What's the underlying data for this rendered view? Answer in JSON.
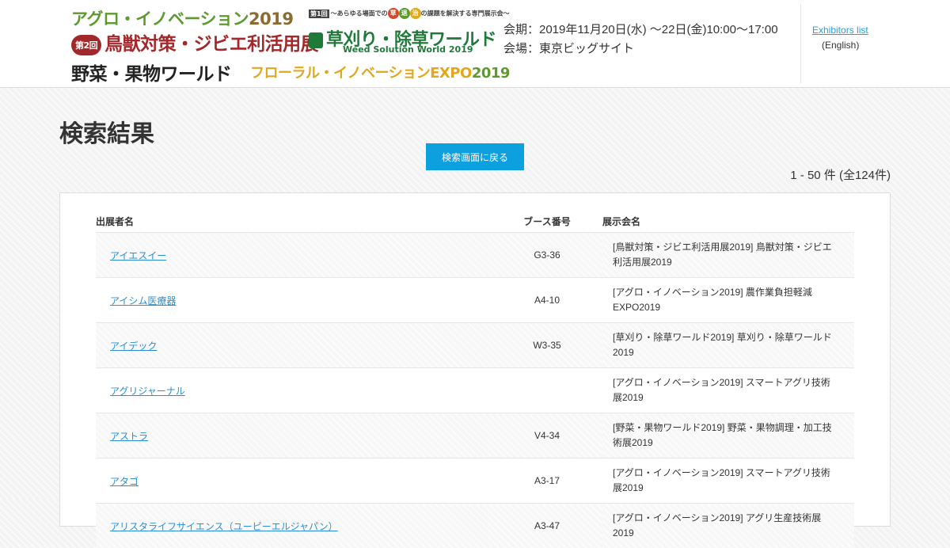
{
  "header": {
    "logo": {
      "agro": "アグロ・イノベーション",
      "agro_year": "2019",
      "tagline_badge": "第1回",
      "tagline": "～あらゆる場面での",
      "tagline_chars": [
        "草",
        "退",
        "治"
      ],
      "tagline_end": "の課題を解決する専門展示会～",
      "chouju_badge": "第2回",
      "chouju": "鳥獣対策・ジビエ利活用展",
      "kusa": "草刈り・除草ワールド",
      "weed": "Weed Solution World 2019",
      "yasai": "野菜・果物ワールド",
      "floral": "フローラル・イノベーションEXPO",
      "floral_year": "2019"
    },
    "dates_line1": "会期：2019年11月20日(水) ～22日(金)10:00～17:00",
    "dates_line2": "会場：東京ビッグサイト",
    "exhibitors_link": "Exhibitors list",
    "english_label": "(English)"
  },
  "main": {
    "title": "検索結果",
    "back_button": "検索画面に戻る",
    "count": "1 - 50 件 (全124件)"
  },
  "table": {
    "headers": [
      "出展者名",
      "ブース番号",
      "展示会名"
    ],
    "rows": [
      {
        "name": "アイエスイー",
        "booth": "G3-36",
        "show": "[鳥獣対策・ジビエ利活用展2019] 鳥獣対策・ジビエ利活用展2019"
      },
      {
        "name": "アイシム医療器",
        "booth": "A4-10",
        "show": "[アグロ・イノベーション2019] 農作業負担軽減EXPO2019"
      },
      {
        "name": "アイデック",
        "booth": "W3-35",
        "show": "[草刈り・除草ワールド2019] 草刈り・除草ワールド2019"
      },
      {
        "name": "アグリジャーナル",
        "booth": "",
        "show": "[アグロ・イノベーション2019] スマートアグリ技術展2019"
      },
      {
        "name": "アストラ",
        "booth": "V4-34",
        "show": "[野菜・果物ワールド2019] 野菜・果物調理・加工技術展2019"
      },
      {
        "name": "アタゴ",
        "booth": "A3-17",
        "show": "[アグロ・イノベーション2019] スマートアグリ技術展2019"
      },
      {
        "name": "アリスタライフサイエンス（ユーピーエルジャパン）",
        "booth": "A3-47",
        "show": "[アグロ・イノベーション2019] アグリ生産技術展2019"
      }
    ]
  },
  "colors": {
    "accent": "#0ca0df",
    "link": "#2a8fd0",
    "agro_green": "#5c9a2e",
    "chouju_red": "#a2292b",
    "kusa_green": "#1f7a3a",
    "floral_yellow": "#e0a81a",
    "tagline_dots": [
      "#d9452b",
      "#5c9a2e",
      "#e0a81a"
    ]
  },
  "icons": {
    "kusa_logo": "weed-cutter-icon"
  }
}
